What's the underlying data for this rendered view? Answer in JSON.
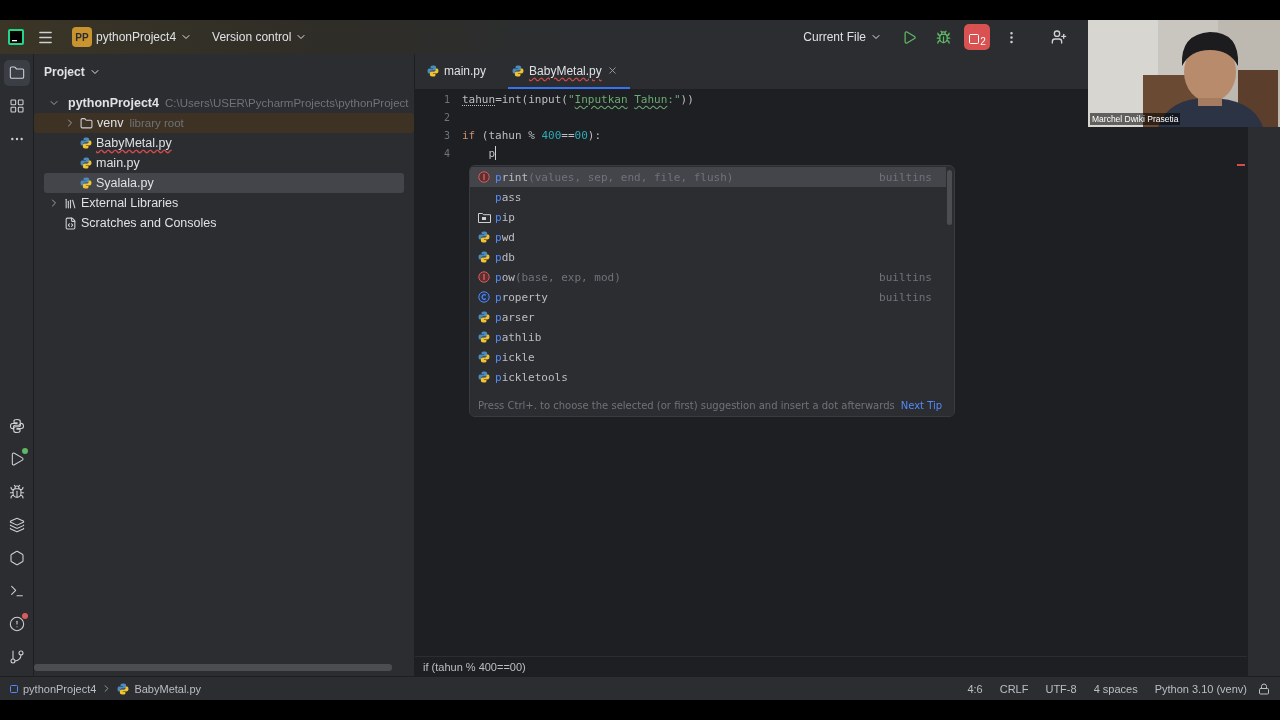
{
  "title_bar": {
    "project_badge": "PP",
    "project": "pythonProject4",
    "vcs": "Version control",
    "run_config": "Current File",
    "stop_count": "2"
  },
  "tool_strip": {
    "top": [
      {
        "kind": "project",
        "selected": true
      },
      {
        "kind": "structure",
        "selected": false
      },
      {
        "kind": "more",
        "selected": false
      }
    ],
    "bottom": [
      {
        "kind": "python_console",
        "selected": false
      },
      {
        "kind": "run",
        "selected": false,
        "color": "#5fb865"
      },
      {
        "kind": "debug",
        "selected": false
      },
      {
        "kind": "layers",
        "selected": false
      },
      {
        "kind": "services",
        "selected": false
      },
      {
        "kind": "terminal",
        "selected": false
      },
      {
        "kind": "problems",
        "selected": false,
        "color": "#db5c5c"
      },
      {
        "kind": "git",
        "selected": false
      }
    ]
  },
  "project_panel": {
    "title": "Project",
    "tree": [
      {
        "label": "pythonProject4",
        "hint": "C:\\Users\\USER\\PycharmProjects\\pythonProject",
        "kind": "folder",
        "bold": true,
        "expanded": true,
        "selected": false,
        "error": false,
        "children": [
          {
            "label": "venv",
            "hint": "library root",
            "kind": "library_folder",
            "expanded": false,
            "selected": false,
            "error": false
          },
          {
            "label": "BabyMetal.py",
            "kind": "python",
            "selected": false,
            "error": true
          },
          {
            "label": "main.py",
            "kind": "python",
            "selected": false,
            "error": false
          },
          {
            "label": "Syalala.py",
            "kind": "python",
            "selected": true,
            "error": false
          }
        ]
      },
      {
        "label": "External Libraries",
        "kind": "libraries",
        "expanded": false,
        "selected": false,
        "error": false
      },
      {
        "label": "Scratches and Consoles",
        "kind": "scratches",
        "selected": false,
        "error": false
      }
    ]
  },
  "editor": {
    "tabs": [
      {
        "label": "main.py",
        "selected": false,
        "error": false
      },
      {
        "label": "BabyMetal.py",
        "selected": true,
        "error": true
      }
    ],
    "lines": [
      {
        "number": "1",
        "cursor": false,
        "tokens": [
          {
            "text": "tahun",
            "kind": "warn"
          },
          {
            "text": "=int(input(",
            "kind": "plain"
          },
          {
            "text": "\"",
            "kind": "string"
          },
          {
            "text": "Inputkan",
            "kind": "typo"
          },
          {
            "text": " Tahun",
            "kind": "typo"
          },
          {
            "text": ":\"",
            "kind": "string"
          },
          {
            "text": "))",
            "kind": "plain"
          }
        ]
      },
      {
        "number": "2",
        "cursor": false
      },
      {
        "number": "3",
        "cursor": false,
        "tokens": [
          {
            "text": "if",
            "kind": "keyword"
          },
          {
            "text": " (tahun % ",
            "kind": "plain"
          },
          {
            "text": "400",
            "kind": "number"
          },
          {
            "text": "==",
            "kind": "plain"
          },
          {
            "text": "00",
            "kind": "number"
          },
          {
            "text": "):",
            "kind": "plain"
          }
        ]
      },
      {
        "number": "4",
        "cursor": true,
        "tokens": [
          {
            "text": "    p",
            "kind": "plain"
          }
        ]
      }
    ],
    "completion": {
      "items": [
        {
          "kind": "function",
          "match": "p",
          "rest": "rint",
          "params": "(values, sep, end, file, flush)",
          "source": "builtins",
          "selected": true
        },
        {
          "kind": "keyword",
          "match": "p",
          "rest": "ass",
          "selected": false
        },
        {
          "kind": "package",
          "match": "p",
          "rest": "ip",
          "selected": false
        },
        {
          "kind": "module",
          "match": "p",
          "rest": "wd",
          "selected": false
        },
        {
          "kind": "module",
          "match": "p",
          "rest": "db",
          "selected": false
        },
        {
          "kind": "function",
          "match": "p",
          "rest": "ow",
          "params": "(base, exp, mod)",
          "source": "builtins",
          "selected": false
        },
        {
          "kind": "class",
          "match": "p",
          "rest": "roperty",
          "source": "builtins",
          "selected": false
        },
        {
          "kind": "module",
          "match": "p",
          "rest": "arser",
          "selected": false
        },
        {
          "kind": "module",
          "match": "p",
          "rest": "athlib",
          "selected": false
        },
        {
          "kind": "module",
          "match": "p",
          "rest": "ickle",
          "selected": false
        },
        {
          "kind": "module",
          "match": "p",
          "rest": "ickletools",
          "selected": false
        }
      ],
      "tip": "Press Ctrl+. to choose the selected (or first) suggestion and insert a dot afterwards",
      "tip_link": "Next Tip"
    },
    "breadcrumb": "if (tahun % 400==00)"
  },
  "status_bar": {
    "path": [
      {
        "label": "pythonProject4",
        "kind": "module"
      },
      {
        "label": "BabyMetal.py",
        "kind": "python"
      }
    ],
    "items": [
      "4:6",
      "CRLF",
      "UTF-8",
      "4 spaces",
      "Python 3.10 (venv)"
    ]
  },
  "webcam": {
    "kind": "picture",
    "caption": "Marchel Dwiki Prasetia"
  }
}
